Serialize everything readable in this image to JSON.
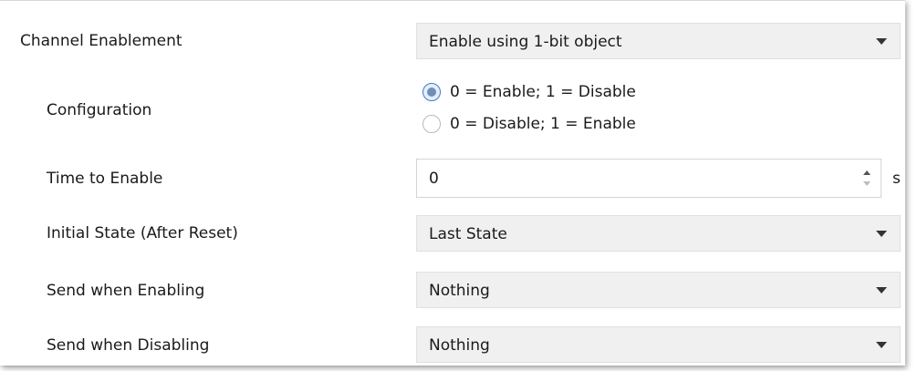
{
  "channel_enablement": {
    "label": "Channel Enablement",
    "value": "Enable using 1-bit object"
  },
  "configuration": {
    "label": "Configuration",
    "options": [
      {
        "label": "0 = Enable; 1 = Disable",
        "checked": true
      },
      {
        "label": "0 = Disable; 1 = Enable",
        "checked": false
      }
    ]
  },
  "time_to_enable": {
    "label": "Time to Enable",
    "value": "0",
    "unit": "s"
  },
  "initial_state": {
    "label": "Initial State (After Reset)",
    "value": "Last State"
  },
  "send_when_enabling": {
    "label": "Send when Enabling",
    "value": "Nothing"
  },
  "send_when_disabling": {
    "label": "Send when Disabling",
    "value": "Nothing"
  },
  "icons": {
    "dropdown": "chevron-down-icon",
    "spin_up": "spin-up-icon",
    "spin_down": "spin-down-icon"
  },
  "colors": {
    "radio_selected_border": "#3b7bd4",
    "combo_background": "#f0f0f0"
  }
}
